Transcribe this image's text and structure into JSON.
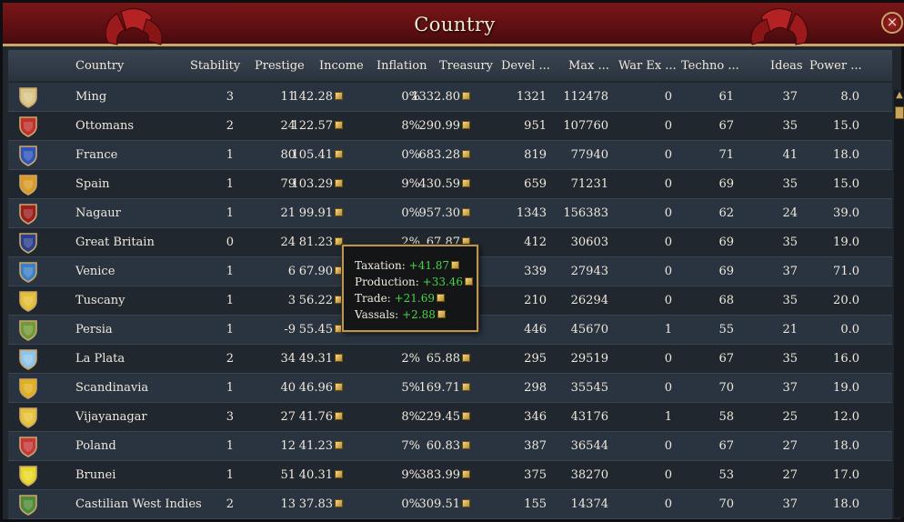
{
  "window": {
    "title": "Country",
    "close_symbol": "×"
  },
  "columns": [
    "Country",
    "Stability",
    "Prestige",
    "Income",
    "Inflation",
    "Treasury",
    "Devel ...",
    "Max  ...",
    "War Ex ...",
    "Techno ...",
    "Ideas",
    "Power  ..."
  ],
  "rows": [
    {
      "flag_icon": "ming-flag-icon",
      "flag_color": "#d9c68a",
      "country": "Ming",
      "stability": "3",
      "prestige": "11",
      "income": "142.28",
      "inflation": "0%",
      "treasury": "1332.80",
      "development": "1321",
      "max": "112478",
      "war_exhaustion": "0",
      "technology": "61",
      "ideas": "37",
      "power": "8.0"
    },
    {
      "flag_icon": "ottomans-flag-icon",
      "flag_color": "#c0302c",
      "country": "Ottomans",
      "stability": "2",
      "prestige": "24",
      "income": "122.57",
      "inflation": "8%",
      "treasury": "290.99",
      "development": "951",
      "max": "107760",
      "war_exhaustion": "0",
      "technology": "67",
      "ideas": "35",
      "power": "15.0"
    },
    {
      "flag_icon": "france-flag-icon",
      "flag_color": "#2f55b8",
      "country": "France",
      "stability": "1",
      "prestige": "80",
      "income": "105.41",
      "inflation": "0%",
      "treasury": "683.28",
      "development": "819",
      "max": "77940",
      "war_exhaustion": "0",
      "technology": "71",
      "ideas": "41",
      "power": "18.0"
    },
    {
      "flag_icon": "spain-flag-icon",
      "flag_color": "#d99a2a",
      "country": "Spain",
      "stability": "1",
      "prestige": "79",
      "income": "103.29",
      "inflation": "9%",
      "treasury": "430.59",
      "development": "659",
      "max": "71231",
      "war_exhaustion": "0",
      "technology": "69",
      "ideas": "35",
      "power": "15.0"
    },
    {
      "flag_icon": "nagaur-flag-icon",
      "flag_color": "#9a2020",
      "country": "Nagaur",
      "stability": "1",
      "prestige": "21",
      "income": "99.91",
      "inflation": "0%",
      "treasury": "957.30",
      "development": "1343",
      "max": "156383",
      "war_exhaustion": "0",
      "technology": "62",
      "ideas": "24",
      "power": "39.0"
    },
    {
      "flag_icon": "great-britain-flag-icon",
      "flag_color": "#2b3f8c",
      "country": "Great Britain",
      "stability": "0",
      "prestige": "24",
      "income": "81.23",
      "inflation": "2%",
      "treasury": "67.87",
      "development": "412",
      "max": "30603",
      "war_exhaustion": "0",
      "technology": "69",
      "ideas": "35",
      "power": "19.0"
    },
    {
      "flag_icon": "venice-flag-icon",
      "flag_color": "#3d7fc4",
      "country": "Venice",
      "stability": "1",
      "prestige": "6",
      "income": "67.90",
      "inflation": "",
      "treasury": "",
      "development": "339",
      "max": "27943",
      "war_exhaustion": "0",
      "technology": "69",
      "ideas": "37",
      "power": "71.0"
    },
    {
      "flag_icon": "tuscany-flag-icon",
      "flag_color": "#e3c037",
      "country": "Tuscany",
      "stability": "1",
      "prestige": "3",
      "income": "56.22",
      "inflation": "",
      "treasury": "",
      "development": "210",
      "max": "26294",
      "war_exhaustion": "0",
      "technology": "68",
      "ideas": "35",
      "power": "20.0"
    },
    {
      "flag_icon": "persia-flag-icon",
      "flag_color": "#6f9a3a",
      "country": "Persia",
      "stability": "1",
      "prestige": "-9",
      "income": "55.45",
      "inflation": "",
      "treasury": "",
      "development": "446",
      "max": "45670",
      "war_exhaustion": "1",
      "technology": "55",
      "ideas": "21",
      "power": "0.0"
    },
    {
      "flag_icon": "la-plata-flag-icon",
      "flag_color": "#8fc4ea",
      "country": "La Plata",
      "stability": "2",
      "prestige": "34",
      "income": "49.31",
      "inflation": "2%",
      "treasury": "65.88",
      "development": "295",
      "max": "29519",
      "war_exhaustion": "0",
      "technology": "67",
      "ideas": "35",
      "power": "16.0"
    },
    {
      "flag_icon": "scandinavia-flag-icon",
      "flag_color": "#e0b020",
      "country": "Scandinavia",
      "stability": "1",
      "prestige": "40",
      "income": "46.96",
      "inflation": "5%",
      "treasury": "169.71",
      "development": "298",
      "max": "35545",
      "war_exhaustion": "0",
      "technology": "70",
      "ideas": "37",
      "power": "19.0"
    },
    {
      "flag_icon": "vijayanagar-flag-icon",
      "flag_color": "#e6c23a",
      "country": "Vijayanagar",
      "stability": "3",
      "prestige": "27",
      "income": "41.76",
      "inflation": "8%",
      "treasury": "229.45",
      "development": "346",
      "max": "43176",
      "war_exhaustion": "1",
      "technology": "58",
      "ideas": "25",
      "power": "12.0"
    },
    {
      "flag_icon": "poland-flag-icon",
      "flag_color": "#c43a3a",
      "country": "Poland",
      "stability": "1",
      "prestige": "12",
      "income": "41.23",
      "inflation": "7%",
      "treasury": "60.83",
      "development": "387",
      "max": "36544",
      "war_exhaustion": "0",
      "technology": "67",
      "ideas": "27",
      "power": "18.0"
    },
    {
      "flag_icon": "brunei-flag-icon",
      "flag_color": "#e8d82a",
      "country": "Brunei",
      "stability": "1",
      "prestige": "51",
      "income": "40.31",
      "inflation": "9%",
      "treasury": "383.99",
      "development": "375",
      "max": "38270",
      "war_exhaustion": "0",
      "technology": "53",
      "ideas": "27",
      "power": "17.0"
    },
    {
      "flag_icon": "castilian-west-indies-flag-icon",
      "flag_color": "#4f8a3a",
      "country": "Castilian West Indies",
      "stability": "2",
      "prestige": "13",
      "income": "37.83",
      "inflation": "0%",
      "treasury": "309.51",
      "development": "155",
      "max": "14374",
      "war_exhaustion": "0",
      "technology": "70",
      "ideas": "37",
      "power": "18.0"
    }
  ],
  "tooltip": {
    "lines": [
      {
        "label": "Taxation:",
        "value": "+41.87"
      },
      {
        "label": "Production:",
        "value": "+33.46"
      },
      {
        "label": "Trade:",
        "value": "+21.69"
      },
      {
        "label": "Vassals:",
        "value": "+2.88"
      }
    ]
  },
  "colors": {
    "title_bar": "#6b1214",
    "gold_trim": "#c9a66b",
    "positive_value": "#49d34a"
  }
}
